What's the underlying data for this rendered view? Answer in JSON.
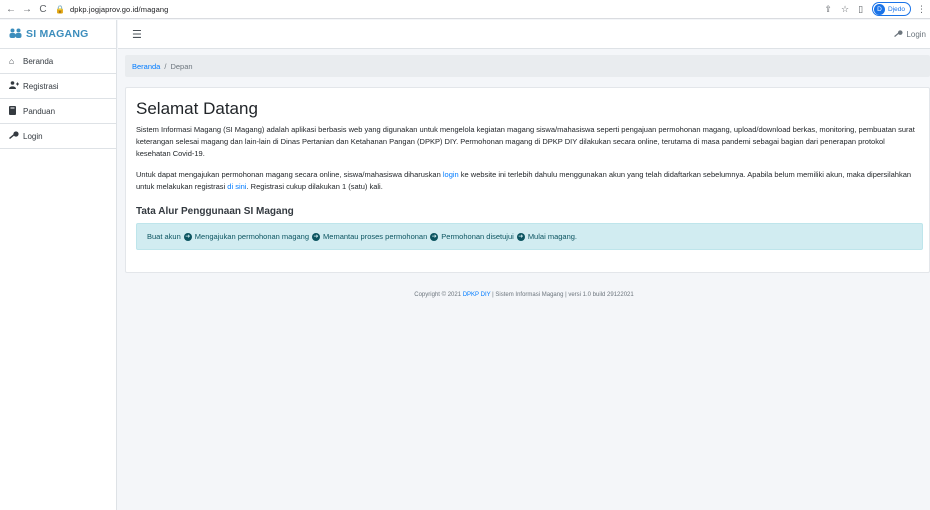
{
  "browser": {
    "url": "dpkp.jogjaprov.go.id/magang",
    "profile_initial": "D",
    "profile_name": "Djedo"
  },
  "brand": {
    "text": "SI MAGANG"
  },
  "sidebar": {
    "items": [
      {
        "label": "Beranda",
        "icon": "home-icon"
      },
      {
        "label": "Registrasi",
        "icon": "user-plus-icon"
      },
      {
        "label": "Panduan",
        "icon": "book-icon"
      },
      {
        "label": "Login",
        "icon": "key-icon"
      }
    ]
  },
  "topbar": {
    "login_label": "Login"
  },
  "breadcrumb": {
    "home": "Beranda",
    "separator": "/",
    "current": "Depan"
  },
  "main": {
    "title": "Selamat Datang",
    "intro": "Sistem Informasi Magang (SI Magang) adalah aplikasi berbasis web yang digunakan untuk mengelola kegiatan magang siswa/mahasiswa seperti pengajuan permohonan magang, upload/download berkas, monitoring, pembuatan surat keterangan selesai magang dan lain-lain di Dinas Pertanian dan Ketahanan Pangan (DPKP) DIY. Permohonan magang di DPKP DIY dilakukan secara online, terutama di masa pandemi sebagai bagian dari penerapan protokol kesehatan Covid-19.",
    "para2_a": "Untuk dapat mengajukan permohonan magang secara online, siswa/mahasiswa diharuskan ",
    "para2_link1": "login",
    "para2_b": " ke website ini terlebih dahulu menggunakan akun yang telah didaftarkan sebelumnya. Apabila belum memiliki akun, maka dipersilahkan untuk melakukan registrasi ",
    "para2_link2": "di sini",
    "para2_c": ". Registrasi cukup dilakukan 1 (satu) kali.",
    "flow_title": "Tata Alur Penggunaan SI Magang",
    "flow_steps": [
      "Buat akun",
      "Mengajukan permohonan magang",
      "Memantau proses permohonan",
      "Permohonan disetujui",
      "Mulai magang."
    ]
  },
  "footer": {
    "prefix": "Copyright © 2021 ",
    "org_link": "DPKP DIY",
    "suffix": " | Sistem Informasi Magang | versi 1.0 build 29122021"
  },
  "colors": {
    "brand": "#3c8dbc",
    "link": "#007bff",
    "alert_bg": "#d1ecf1",
    "alert_text": "#0c5460"
  }
}
